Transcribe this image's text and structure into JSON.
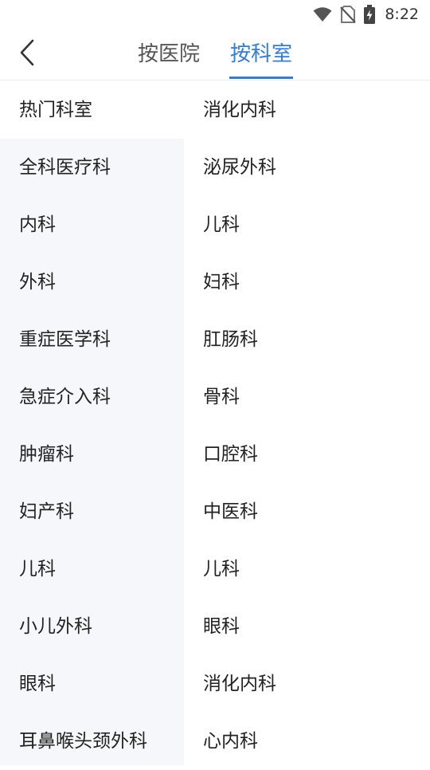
{
  "status_bar": {
    "time": "8:22",
    "icons": [
      "wifi-icon",
      "no-sim-icon",
      "battery-charging-icon"
    ]
  },
  "nav": {
    "back_icon": "chevron-left-icon",
    "tabs": [
      {
        "label": "按医院",
        "active": false
      },
      {
        "label": "按科室",
        "active": true
      }
    ]
  },
  "colors": {
    "accent": "#2f7de1",
    "left_bg": "#f6f7fa",
    "text": "#222222"
  },
  "categories": [
    {
      "label": "热门科室",
      "selected": true
    },
    {
      "label": "全科医疗科"
    },
    {
      "label": "内科"
    },
    {
      "label": "外科"
    },
    {
      "label": "重症医学科"
    },
    {
      "label": "急症介入科"
    },
    {
      "label": "肿瘤科"
    },
    {
      "label": "妇产科"
    },
    {
      "label": "儿科"
    },
    {
      "label": "小儿外科"
    },
    {
      "label": "眼科"
    },
    {
      "label": "耳鼻喉头颈外科"
    }
  ],
  "departments": [
    {
      "label": "消化内科"
    },
    {
      "label": "泌尿外科"
    },
    {
      "label": "儿科"
    },
    {
      "label": "妇科"
    },
    {
      "label": "肛肠科"
    },
    {
      "label": "骨科"
    },
    {
      "label": "口腔科"
    },
    {
      "label": "中医科"
    },
    {
      "label": "儿科"
    },
    {
      "label": "眼科"
    },
    {
      "label": "消化内科"
    },
    {
      "label": "心内科"
    }
  ]
}
